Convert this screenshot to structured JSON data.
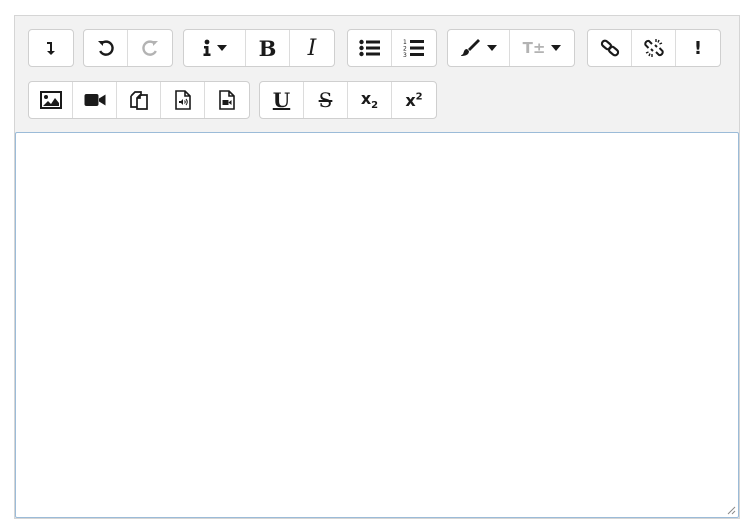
{
  "toolbar": {
    "collapse": {
      "icon": "collapse-arrow-icon"
    },
    "undo": {
      "icon": "undo-icon"
    },
    "redo": {
      "icon": "redo-icon",
      "disabled": true
    },
    "info": {
      "icon": "info-icon"
    },
    "bold": {
      "glyph": "B"
    },
    "italic": {
      "glyph": "I"
    },
    "unordered_list": {
      "icon": "bulleted-list-icon"
    },
    "ordered_list": {
      "icon": "numbered-list-icon"
    },
    "color": {
      "icon": "paintbrush-icon"
    },
    "font_size": {
      "glyph": "T±",
      "disabled": true
    },
    "link": {
      "icon": "link-icon"
    },
    "unlink": {
      "icon": "unlink-icon"
    },
    "emphasis": {
      "glyph": "!"
    },
    "image": {
      "icon": "image-icon"
    },
    "video": {
      "icon": "video-icon"
    },
    "copy": {
      "icon": "copy-icon"
    },
    "audio_file": {
      "icon": "audio-file-icon"
    },
    "video_file": {
      "icon": "video-file-icon"
    },
    "underline": {
      "glyph": "U"
    },
    "strike": {
      "glyph": "S"
    },
    "subscript": {
      "glyph": "x",
      "sub": "2"
    },
    "superscript": {
      "glyph": "x",
      "sup": "2"
    }
  },
  "editor": {
    "content": ""
  },
  "colors": {
    "toolbar_bg": "#f2f2f2",
    "border": "#d5d5d5",
    "focus_border": "#9bbbd8",
    "disabled": "#b3b3b3"
  }
}
